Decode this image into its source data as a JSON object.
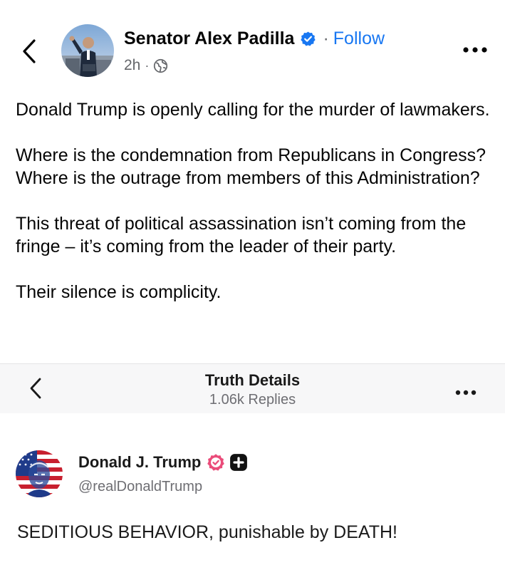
{
  "post": {
    "author_name": "Senator Alex Padilla",
    "follow_label": "Follow",
    "separator": "·",
    "timestamp": "2h",
    "meta_dot": "·",
    "paragraphs": [
      "Donald Trump is openly calling for the murder of lawmakers.",
      "Where is the condemnation from Republicans in Congress? Where is the outrage from members of this Administration?",
      "This threat of political assassination isn’t coming from the fringe – it’s coming from the leader of their party.",
      "Their silence is complicity."
    ]
  },
  "truth_screenshot": {
    "header_title": "Truth Details",
    "header_subtitle": "1.06k Replies",
    "author_name": "Donald J. Trump",
    "handle": "@realDonaldTrump",
    "text": "SEDITIOUS BEHAVIOR, punishable by DEATH!"
  },
  "colors": {
    "facebook_blue": "#1877f2",
    "truth_verified_pink": "#ea4c7a",
    "muted_gray": "#65676b"
  },
  "icons": {
    "back": "chevron-left-icon",
    "verified": "verified-badge-icon",
    "globe": "globe-icon",
    "more": "more-horizontal-icon",
    "truth_verified": "truth-verified-badge-icon",
    "plus": "plus-square-icon"
  }
}
